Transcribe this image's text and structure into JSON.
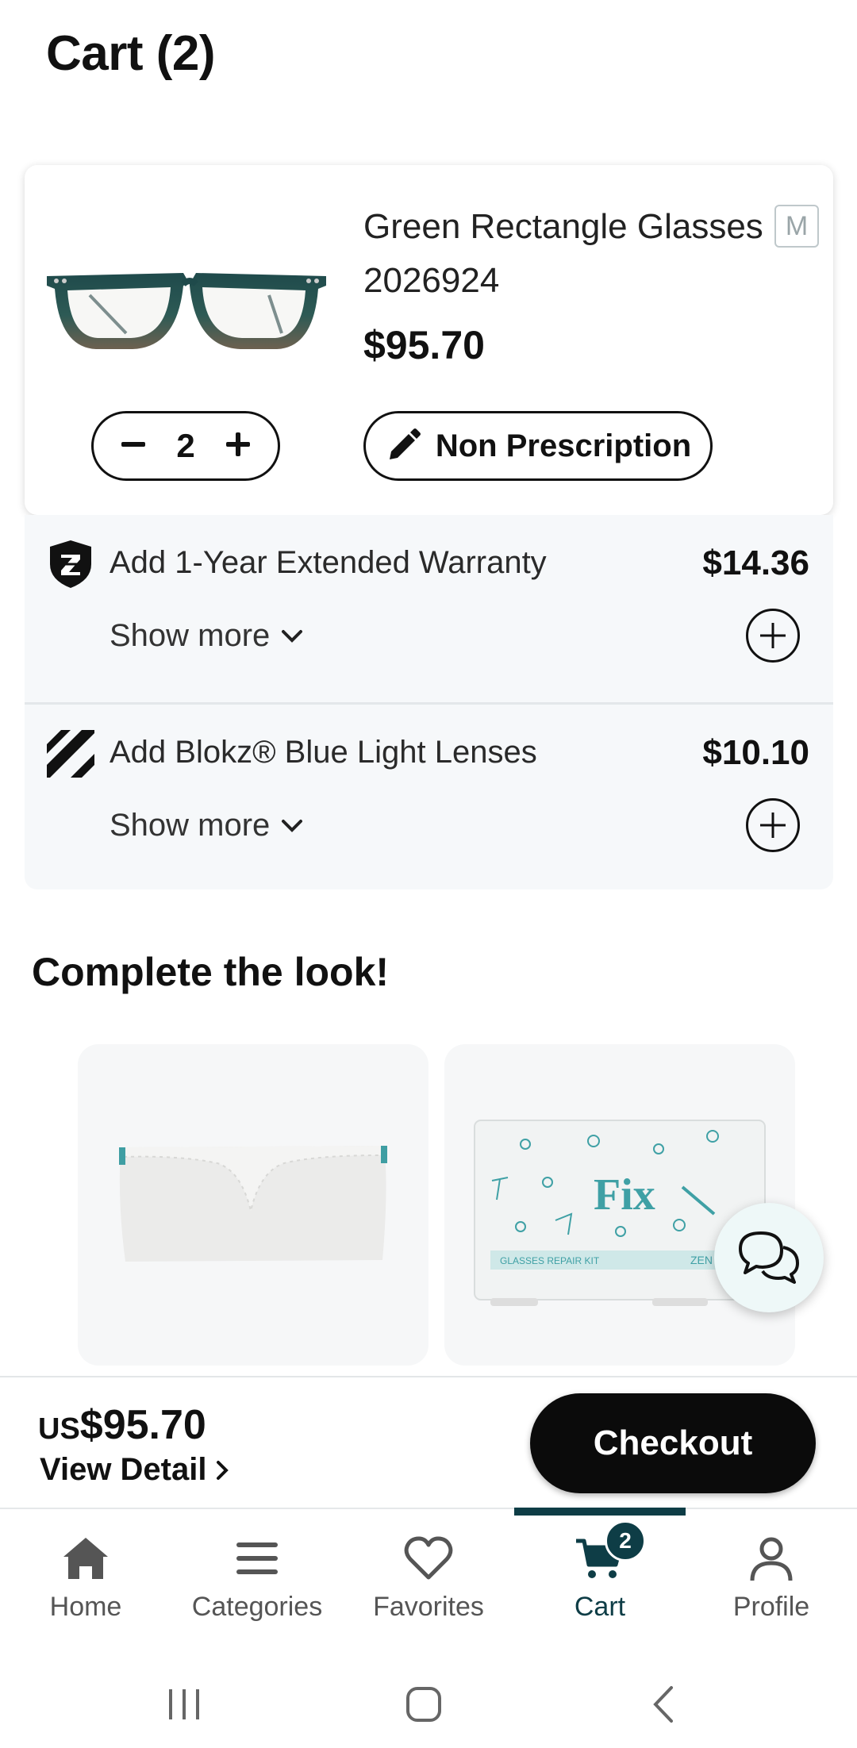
{
  "header": {
    "title": "Cart (2)"
  },
  "cart_item": {
    "name": "Green Rectangle Glasses 2026924",
    "size": "M",
    "price": "$95.70",
    "quantity": "2",
    "prescription_label": "Non Prescription"
  },
  "addons": [
    {
      "label": "Add 1-Year Extended Warranty",
      "price": "$14.36",
      "show_more": "Show more",
      "icon": "shield-z-icon"
    },
    {
      "label": "Add Blokz® Blue Light Lenses",
      "price": "$10.10",
      "show_more": "Show more",
      "icon": "blokz-stripes-icon"
    }
  ],
  "recommendations": {
    "title": "Complete the look!",
    "items": [
      {
        "name": "glasses-case",
        "image_text": ""
      },
      {
        "name": "repair-kit",
        "image_text": "Fix",
        "sub_text": "GLASSES REPAIR KIT",
        "brand_text": "ZEN"
      }
    ]
  },
  "summary": {
    "currency_prefix": "US",
    "total": "$95.70",
    "view_detail": "View Detail",
    "checkout_label": "Checkout"
  },
  "tabbar": {
    "items": [
      {
        "label": "Home",
        "icon": "home-icon"
      },
      {
        "label": "Categories",
        "icon": "menu-icon"
      },
      {
        "label": "Favorites",
        "icon": "heart-icon"
      },
      {
        "label": "Cart",
        "icon": "cart-icon",
        "badge": "2",
        "active": true
      },
      {
        "label": "Profile",
        "icon": "user-icon"
      }
    ]
  },
  "colors": {
    "accent": "#0e3d46",
    "addon_bg": "#f6f8fa",
    "checkout_bg": "#0b0b0b"
  }
}
